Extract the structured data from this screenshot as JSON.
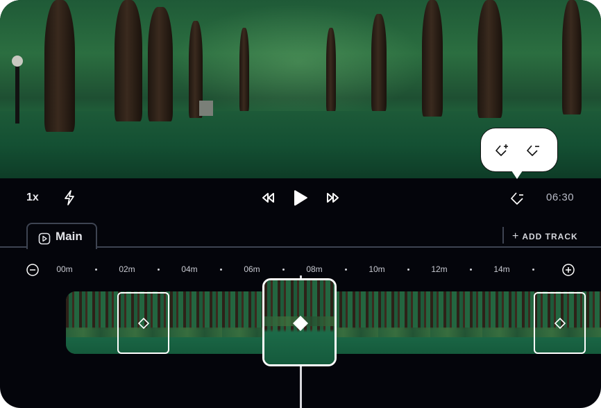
{
  "player": {
    "speed_label": "1x",
    "time_label": "06:30",
    "icons": {
      "speed": "speed-label",
      "flash": "lightning-bolt-icon",
      "rewind": "rewind-icon",
      "play": "play-icon",
      "forward": "fast-forward-icon",
      "keyframe": "keyframe-icon"
    }
  },
  "keyframe_popup": {
    "add_label": "add-keyframe",
    "remove_label": "remove-keyframe"
  },
  "tracks": {
    "active_tab": "Main",
    "add_track_label": "ADD TRACK"
  },
  "timeline": {
    "zoom_out": "zoom-out",
    "zoom_in": "zoom-in",
    "ticks": [
      "00m",
      "02m",
      "04m",
      "06m",
      "08m",
      "10m",
      "12m",
      "14m"
    ],
    "playhead_time": "08m",
    "keyframes": [
      {
        "type": "keyframe",
        "selected": false
      },
      {
        "type": "keyframe",
        "selected": true
      },
      {
        "type": "keyframe",
        "selected": false
      }
    ]
  },
  "colors": {
    "background": "#04050b",
    "accent": "#ffffff",
    "divider": "#3e4452",
    "muted_text": "#c8cad2"
  }
}
